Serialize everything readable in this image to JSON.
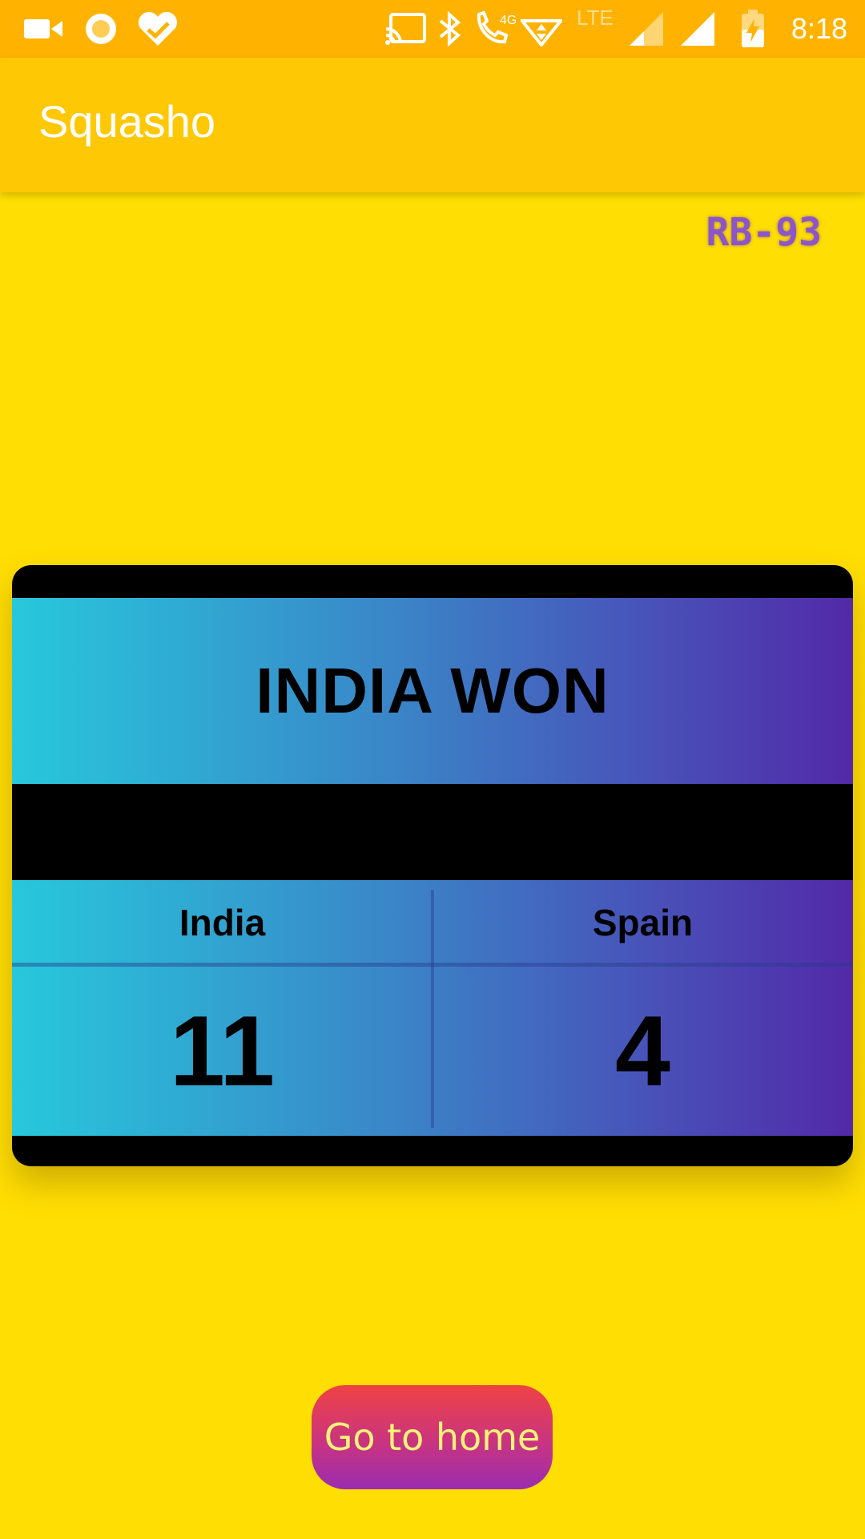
{
  "status_bar": {
    "time": "8:18",
    "network_label": "4G",
    "lte_label": "LTE",
    "icons": [
      "video-camera-icon",
      "circle-record-icon",
      "heart-check-icon",
      "cast-icon",
      "bluetooth-icon",
      "wifi-call-icon",
      "data-arrows-icon",
      "signal-weak-icon",
      "signal-full-icon",
      "battery-charging-icon"
    ]
  },
  "app_bar": {
    "title": "Squasho"
  },
  "code_tag": "RB-93",
  "result": {
    "headline": "INDIA WON"
  },
  "teams": [
    {
      "name": "India",
      "score": "11"
    },
    {
      "name": "Spain",
      "score": "4"
    }
  ],
  "home_button": {
    "label": "Go to home"
  },
  "colors": {
    "background": "#FFDE03",
    "status_bar": "#FFB300",
    "app_bar": "#FFC805",
    "gradient_start": "#27C8DB",
    "gradient_end": "#5229A8",
    "code_tag": "#8C55C9",
    "button_text": "#FFF27A"
  }
}
